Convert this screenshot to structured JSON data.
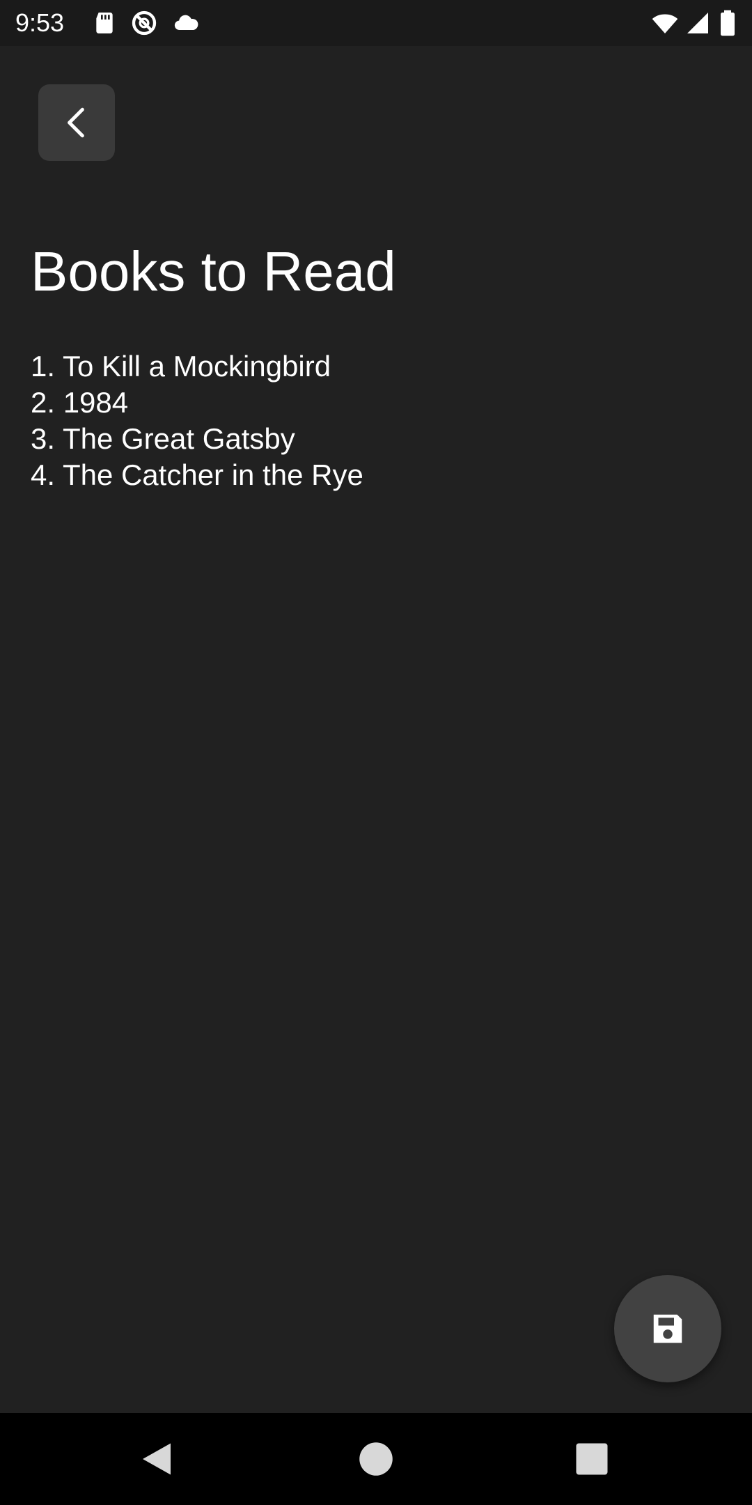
{
  "status_bar": {
    "time": "9:53",
    "icons_left": [
      "sd-card-icon",
      "no-sync-icon",
      "cloud-icon"
    ],
    "icons_right": [
      "wifi-icon",
      "signal-icon",
      "battery-icon"
    ]
  },
  "toolbar": {
    "back_icon": "chevron-left-icon"
  },
  "note": {
    "title": "Books to Read",
    "lines": [
      "1. To Kill a Mockingbird",
      "2. 1984",
      "3. The Great Gatsby",
      "4. The Catcher in the Rye"
    ]
  },
  "fab": {
    "icon": "save-icon"
  },
  "nav_bar": {
    "icons": [
      "back-triangle-icon",
      "home-circle-icon",
      "recents-square-icon"
    ]
  },
  "colors": {
    "background": "#212121",
    "status_bar": "#1a1a1a",
    "button_surface": "#3a3a3a",
    "fab_surface": "#424242",
    "nav_bar": "#000000",
    "text": "#ffffff"
  }
}
